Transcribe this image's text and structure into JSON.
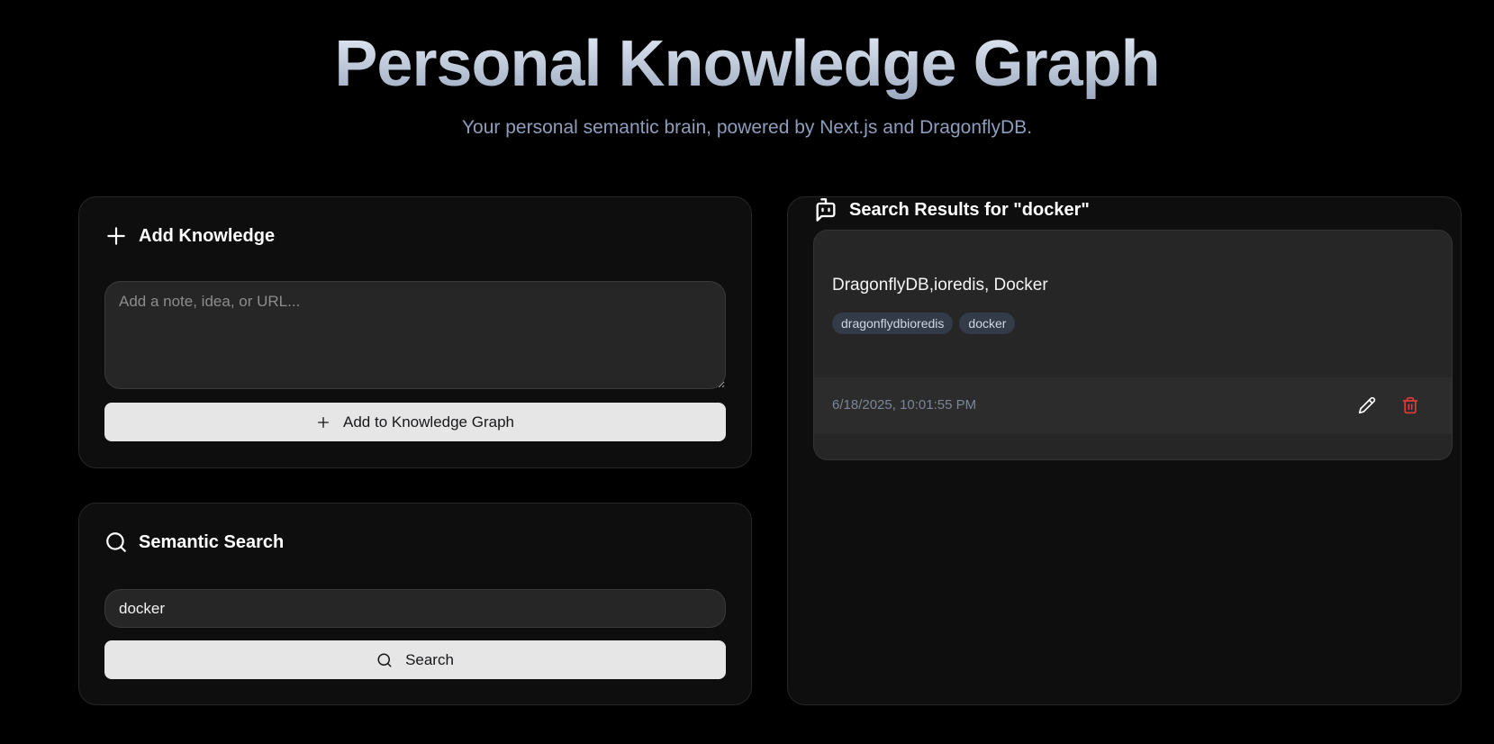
{
  "header": {
    "title": "Personal Knowledge Graph",
    "subtitle": "Your personal semantic brain, powered by Next.js and DragonflyDB."
  },
  "add_knowledge": {
    "heading": "Add Knowledge",
    "heading_icon": "plus-icon",
    "note_placeholder": "Add a note, idea, or URL...",
    "note_value": "",
    "button_label": "Add to Knowledge Graph",
    "button_icon": "plus-icon"
  },
  "semantic_search": {
    "heading": "Semantic Search",
    "heading_icon": "search-icon",
    "query_value": "docker",
    "button_label": "Search",
    "button_icon": "search-icon"
  },
  "results": {
    "heading": "Search Results for \"docker\"",
    "heading_icon": "bot-message-icon",
    "items": [
      {
        "title": "DragonflyDB,ioredis, Docker",
        "tags": [
          "dragonflydbioredis",
          "docker"
        ],
        "timestamp": "6/18/2025, 10:01:55 PM",
        "actions": [
          "edit-icon",
          "delete-icon"
        ]
      }
    ]
  },
  "colors": {
    "background": "#000000",
    "card": "#0e0e0e",
    "input": "#262626",
    "button": "#e6e6e7",
    "tag": "#333a48",
    "delete": "#e5383b",
    "subtitle": "#8e9dbb"
  }
}
